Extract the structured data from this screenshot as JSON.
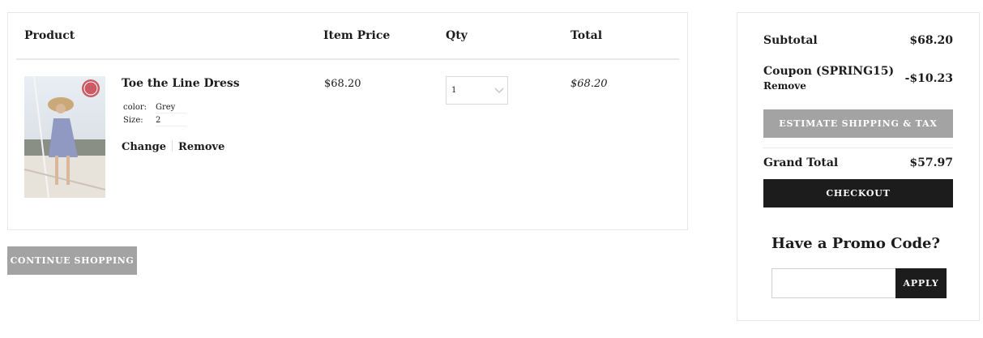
{
  "cart": {
    "headers": {
      "product": "Product",
      "item_price": "Item Price",
      "qty": "Qty",
      "total": "Total"
    },
    "items": [
      {
        "name": "Toe the Line Dress",
        "attributes": [
          {
            "key": "color:",
            "value": "Grey"
          },
          {
            "key": "Size:",
            "value": "2"
          }
        ],
        "change_label": "Change",
        "remove_label": "Remove",
        "price": "$68.20",
        "qty": "1",
        "total": "$68.20",
        "image_icon": "product-photo-dress"
      }
    ]
  },
  "continue_shopping_label": "CONTINUE SHOPPING",
  "summary": {
    "subtotal_label": "Subtotal",
    "subtotal_value": "$68.20",
    "coupon_label": "Coupon (SPRING15)",
    "coupon_remove_label": "Remove",
    "coupon_value": "-$10.23",
    "estimate_label": "ESTIMATE SHIPPING & TAX",
    "grand_total_label": "Grand Total",
    "grand_total_value": "$57.97",
    "checkout_label": "CHECKOUT"
  },
  "promo": {
    "title": "Have a Promo Code?",
    "input_value": "",
    "apply_label": "APPLY"
  },
  "colors": {
    "primary_dark": "#1c1c1c",
    "secondary_gray": "#a3a3a3",
    "border": "#e6e6e6"
  }
}
